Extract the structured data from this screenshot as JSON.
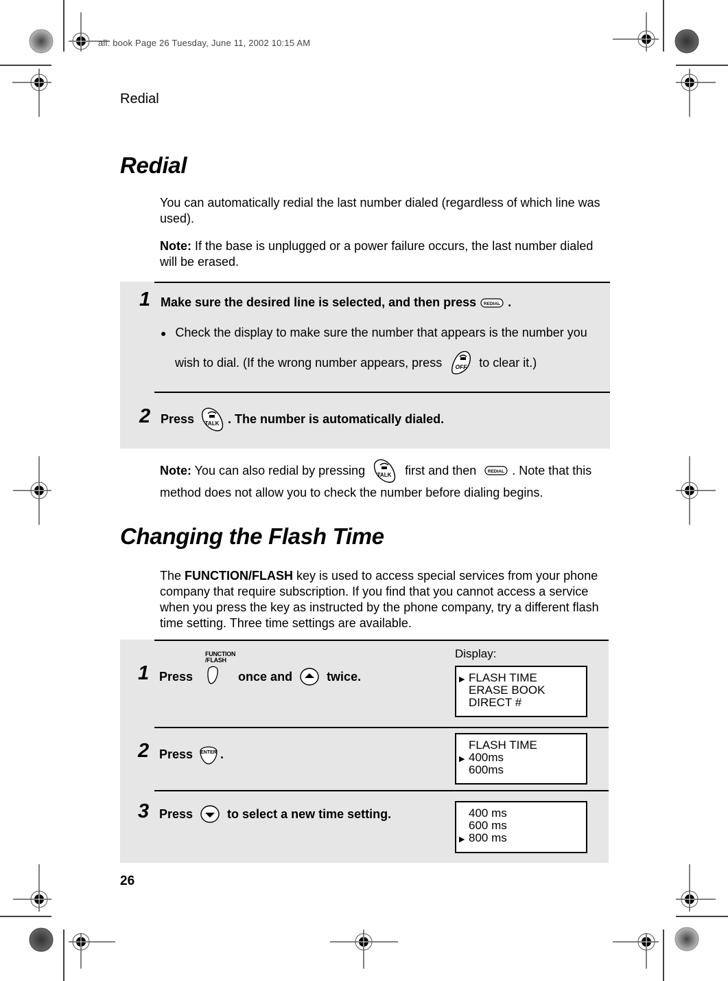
{
  "slug": "all. book  Page 26  Tuesday, June 11, 2002  10:15 AM",
  "running_head": "Redial",
  "page_number": "26",
  "redial_section": {
    "title": "Redial",
    "intro": "You can automatically redial the last number dialed (regardless of which line was used).",
    "note_label": "Note:",
    "note_text": " If the base is unplugged or a power failure occurs, the last number dialed will be erased.",
    "steps": [
      {
        "number": "1",
        "text_before": "Make sure the desired line is selected, and then press",
        "key": "REDIAL",
        "text_after": ".",
        "bullet_line1": "Check the display to make sure the number that appears is the number you",
        "bullet_line2_before": "wish to dial. (If the wrong number appears, press",
        "bullet_key": "OFF",
        "bullet_line2_after": "to clear it.)"
      },
      {
        "number": "2",
        "text_before": "Press",
        "key": "TALK",
        "text_after": ". The number is automatically dialed."
      }
    ],
    "note2_label": "Note:",
    "note2_before": " You can also redial by pressing",
    "note2_key1": "TALK",
    "note2_middle": "first and then",
    "note2_key2": "REDIAL",
    "note2_after": ". Note that this",
    "note2_line2": "method does not allow you to check the number before dialing begins."
  },
  "flash_section": {
    "title": "Changing the Flash Time",
    "intro_before": "The ",
    "intro_bold": "FUNCTION/FLASH",
    "intro_after": " key is used to access special services from your phone company that require subscription. If you find that you cannot access a service when you press the key as instructed by the phone company, try a different flash time setting. Three time settings are available.",
    "display_label": "Display:",
    "steps": [
      {
        "number": "1",
        "press": "Press",
        "key1": "FUNCTION /FLASH",
        "key1_line1": "FUNCTION",
        "key1_line2": "/FLASH",
        "middle": "once and",
        "key2": "up-arrow",
        "after": "twice.",
        "display": [
          {
            "text": "FLASH TIME",
            "selected": true
          },
          {
            "text": "ERASE BOOK",
            "selected": false
          },
          {
            "text": "DIRECT #",
            "selected": false
          }
        ]
      },
      {
        "number": "2",
        "press": "Press",
        "key1": "ENTER",
        "after": ".",
        "display": [
          {
            "text": "FLASH TIME",
            "selected": false
          },
          {
            "text": "400ms",
            "selected": true
          },
          {
            "text": "600ms",
            "selected": false
          }
        ]
      },
      {
        "number": "3",
        "press": "Press",
        "key1": "down-arrow",
        "after": "to select a new time setting.",
        "display": [
          {
            "text": "400 ms",
            "selected": false
          },
          {
            "text": "600 ms",
            "selected": false
          },
          {
            "text": "800 ms",
            "selected": true
          }
        ]
      }
    ]
  },
  "colors": {
    "panel_bg": "#e6e6e6",
    "text": "#000000"
  }
}
